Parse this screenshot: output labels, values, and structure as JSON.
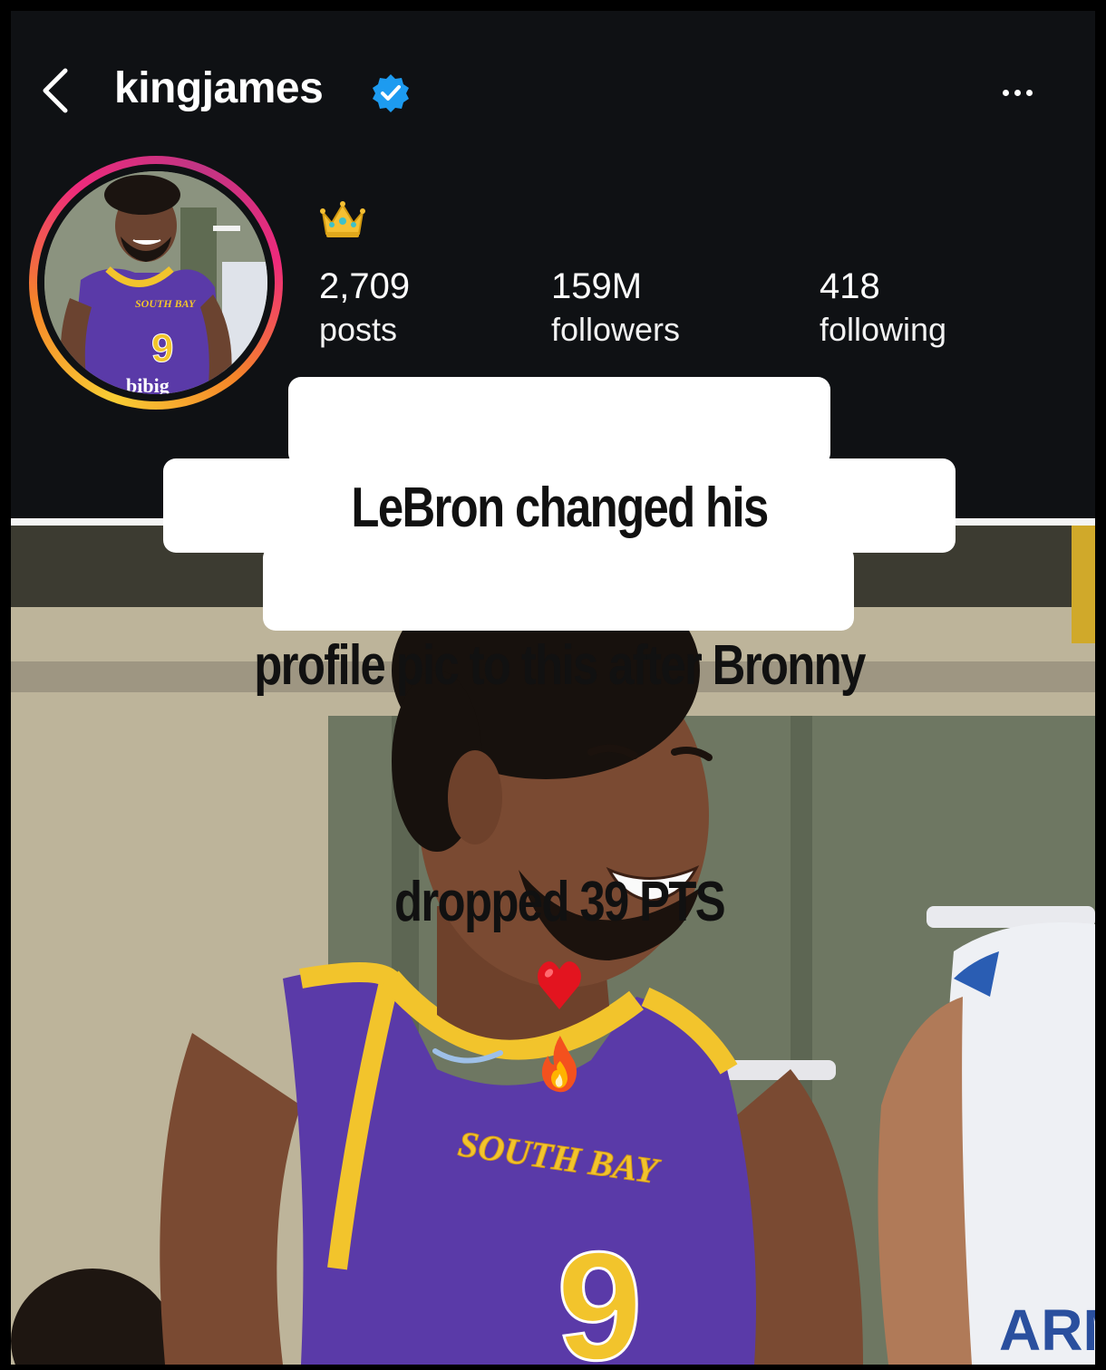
{
  "header": {
    "username": "kingjames",
    "verified": true,
    "back_icon": "chevron-left-icon",
    "more_icon": "more-horizontal-icon"
  },
  "profile": {
    "bio_emoji": "crown-emoji",
    "stats": {
      "posts": {
        "value": "2,709",
        "label": "posts"
      },
      "followers": {
        "value": "159M",
        "label": "followers"
      },
      "following": {
        "value": "418",
        "label": "following"
      }
    }
  },
  "avatar": {
    "jersey_text": "SOUTH BAY",
    "jersey_number": "9",
    "sponsor_text": "bibig"
  },
  "caption": {
    "line1": "LeBron changed his",
    "line2": "profile pic to this after Bronny",
    "line3": "dropped 39 PTS",
    "emojis": [
      "red-heart-emoji",
      "fire-emoji"
    ]
  },
  "photo": {
    "jersey_text": "SOUTH BAY",
    "jersey_number": "9",
    "opponent_text": "ARM"
  },
  "colors": {
    "background": "#0f1114",
    "verified_blue": "#1d9bf0",
    "jersey_purple": "#5a3aa8",
    "jersey_gold": "#f2c42c"
  }
}
